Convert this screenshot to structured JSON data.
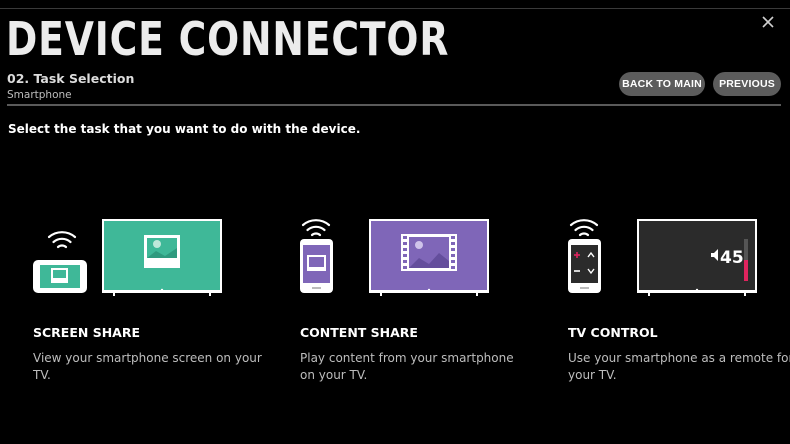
{
  "window": {
    "title": "DEVICE CONNECTOR",
    "close_icon": "close-icon"
  },
  "header": {
    "step": "02. Task Selection",
    "device": "Smartphone",
    "back_label": "BACK TO MAIN",
    "previous_label": "PREVIOUS"
  },
  "instruction": "Select the task that you want to do with the device.",
  "tasks": [
    {
      "title": "SCREEN SHARE",
      "description": "View your smartphone screen on your TV.",
      "accent": "#3fb898",
      "icon": "screen-share-illustration"
    },
    {
      "title": "CONTENT SHARE",
      "description": "Play content from your smartphone on your TV.",
      "accent": "#7f66b8",
      "icon": "content-share-illustration"
    },
    {
      "title": "TV CONTROL",
      "description": "Use your smartphone as a remote for your TV.",
      "accent": "#2b2b2b",
      "icon": "tv-control-illustration",
      "volume_value": "45",
      "volume_accent": "#e0245e"
    }
  ]
}
